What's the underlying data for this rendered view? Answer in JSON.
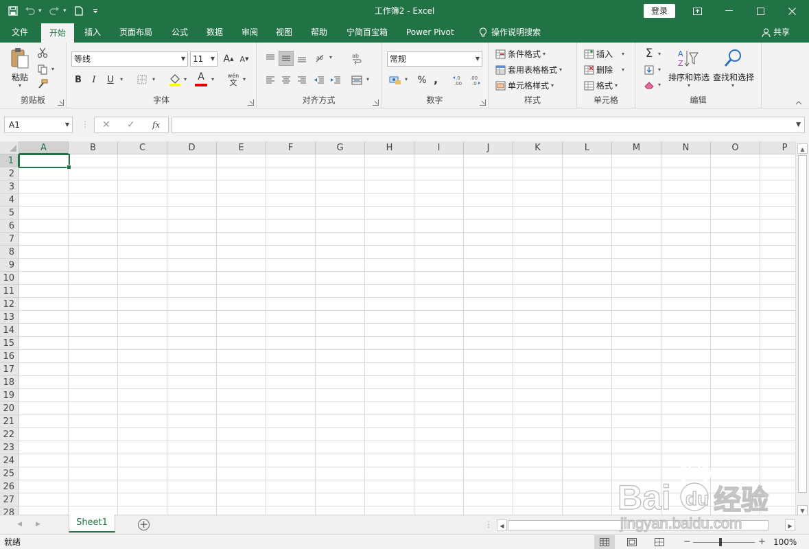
{
  "window": {
    "title": "工作簿2  -  Excel",
    "login_label": "登录",
    "share_label": "共享"
  },
  "tabs": [
    {
      "label": "文件"
    },
    {
      "label": "开始"
    },
    {
      "label": "插入"
    },
    {
      "label": "页面布局"
    },
    {
      "label": "公式"
    },
    {
      "label": "数据"
    },
    {
      "label": "审阅"
    },
    {
      "label": "视图"
    },
    {
      "label": "帮助"
    },
    {
      "label": "宁简百宝箱"
    },
    {
      "label": "Power Pivot"
    },
    {
      "label": "操作说明搜索"
    }
  ],
  "ribbon": {
    "clipboard": {
      "label": "剪贴板",
      "paste_label": "粘贴"
    },
    "font": {
      "label": "字体",
      "font_name": "等线",
      "font_size": "11",
      "grow": "A",
      "shrink": "A",
      "bold": "B",
      "italic": "I",
      "underline": "U",
      "color_letter": "A",
      "phonetic_top": "wén",
      "phonetic_bottom": "文"
    },
    "alignment": {
      "label": "对齐方式"
    },
    "number": {
      "label": "数字",
      "format": "常规",
      "percent": "%",
      "comma": ",",
      "inc_decimal": "←.0\n.00",
      "dec_decimal": ".00\n→.0"
    },
    "styles": {
      "label": "样式",
      "conditional": "条件格式",
      "table_format": "套用表格格式",
      "cell_styles": "单元格样式"
    },
    "cells": {
      "label": "单元格",
      "insert": "插入",
      "delete": "删除",
      "format": "格式"
    },
    "editing": {
      "label": "编辑",
      "sort_filter": "排序和筛选",
      "find_select": "查找和选择",
      "sigma": "Σ"
    }
  },
  "formula_bar": {
    "name_box": "A1",
    "fx": "fx",
    "value": ""
  },
  "grid": {
    "columns": [
      "A",
      "B",
      "C",
      "D",
      "E",
      "F",
      "G",
      "H",
      "I",
      "J",
      "K",
      "L",
      "M",
      "N",
      "O",
      "P"
    ],
    "rows": [
      "1",
      "2",
      "3",
      "4",
      "5",
      "6",
      "7",
      "8",
      "9",
      "10",
      "11",
      "12",
      "13",
      "14",
      "15",
      "16",
      "17",
      "18",
      "19",
      "20",
      "21",
      "22",
      "23",
      "24",
      "25",
      "26",
      "27",
      "28"
    ],
    "active_cell": "A1"
  },
  "sheets": [
    {
      "name": "Sheet1"
    }
  ],
  "status": {
    "ready": "就绪",
    "zoom": "100%",
    "zoom_fraction": 0.44
  },
  "colors": {
    "accent": "#217346",
    "ribbon_bg": "#f3f3f3",
    "gridline": "#dadada",
    "header_bg": "#e6e6e6"
  }
}
